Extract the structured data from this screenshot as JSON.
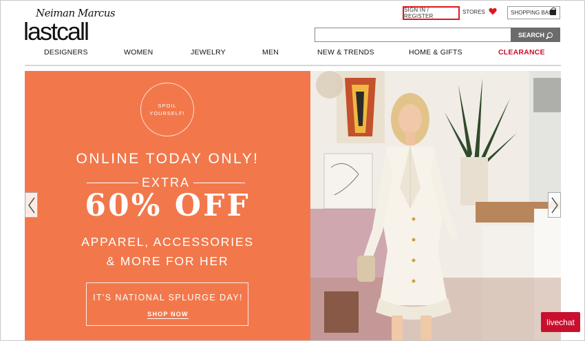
{
  "brand": {
    "top": "Neiman Marcus",
    "main": "lastcall"
  },
  "utility": {
    "signin_label": "SIGN IN / REGISTER",
    "stores_label": "STORES",
    "bag_label": "SHOPPING BAG"
  },
  "search": {
    "value": "",
    "button_label": "SEARCH"
  },
  "nav": {
    "items": [
      {
        "label": "DESIGNERS"
      },
      {
        "label": "WOMEN"
      },
      {
        "label": "JEWELRY"
      },
      {
        "label": "MEN"
      },
      {
        "label": "NEW & TRENDS"
      },
      {
        "label": "HOME & GIFTS"
      },
      {
        "label": "CLEARANCE"
      }
    ]
  },
  "hero": {
    "badge_line1": "SPOIL",
    "badge_line2": "YOURSELF!",
    "headline": "ONLINE TODAY ONLY!",
    "extra": "EXTRA",
    "discount": "60% OFF",
    "sub_line1": "APPAREL, ACCESSORIES",
    "sub_line2": "& MORE FOR HER",
    "box_text": "IT'S NATIONAL SPLURGE DAY!",
    "cta": "SHOP NOW"
  },
  "livechat_label": "livechat",
  "colors": {
    "promo_bg": "#f2784b",
    "accent_red": "#c8102e",
    "search_btn": "#6b6b6b"
  },
  "icons": {
    "favorites": "heart-icon",
    "bag": "shopping-bag-icon",
    "search": "search-icon",
    "prev": "chevron-left-icon",
    "next": "chevron-right-icon"
  }
}
